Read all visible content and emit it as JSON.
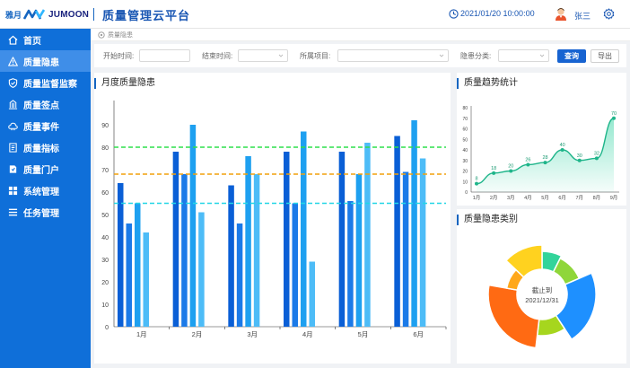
{
  "header": {
    "logo_cn": "雅月",
    "logo_en": "JUMOON",
    "title": "质量管理云平台",
    "datetime": "2021/01/20  10:00:00",
    "username": "张三"
  },
  "sidebar": {
    "items": [
      {
        "label": "首页",
        "icon": "home-icon"
      },
      {
        "label": "质量隐患",
        "icon": "warning-icon",
        "active": true
      },
      {
        "label": "质量监督监察",
        "icon": "shield-icon"
      },
      {
        "label": "质量签点",
        "icon": "checkpoint-icon"
      },
      {
        "label": "质量事件",
        "icon": "cloud-icon"
      },
      {
        "label": "质量指标",
        "icon": "document-icon"
      },
      {
        "label": "质量门户",
        "icon": "portal-icon"
      },
      {
        "label": "系统管理",
        "icon": "grid-icon"
      },
      {
        "label": "任务管理",
        "icon": "list-icon"
      }
    ]
  },
  "breadcrumb": "质量隐患",
  "filters": {
    "start_label": "开始时间:",
    "end_label": "结束时间:",
    "project_label": "所属项目:",
    "category_label": "隐患分类:",
    "query_button": "查询",
    "export_button": "导出"
  },
  "colors": {
    "brand": "#0f6fd9",
    "accent": "#1763d1",
    "line_green": "#1fb58a",
    "threshold_green": "#2ee04b",
    "threshold_orange": "#f2a10c",
    "threshold_cyan": "#23d6e6"
  },
  "monthly_panel": {
    "title": "月度质量隐患"
  },
  "trend_panel": {
    "title": "质量趋势统计"
  },
  "category_panel": {
    "title": "质量隐患类别",
    "center_line1": "截止到",
    "center_line2": "2021/12/31"
  },
  "chart_data": [
    {
      "type": "bar",
      "title": "月度质量隐患",
      "categories": [
        "1月",
        "2月",
        "3月",
        "4月",
        "5月",
        "6月"
      ],
      "series": [
        {
          "values": [
            64,
            78,
            63,
            78,
            78,
            85
          ]
        },
        {
          "values": [
            46,
            68,
            46,
            55,
            56,
            69
          ]
        },
        {
          "values": [
            55,
            90,
            76,
            87,
            68,
            92
          ]
        },
        {
          "values": [
            42,
            51,
            68,
            29,
            82,
            75
          ]
        }
      ],
      "thresholds": [
        80,
        68,
        55
      ],
      "yticks": [
        0,
        10,
        20,
        30,
        40,
        50,
        60,
        70,
        80,
        90
      ],
      "ylim": [
        0,
        100
      ]
    },
    {
      "type": "area",
      "title": "质量趋势统计",
      "categories": [
        "1月",
        "2月",
        "3月",
        "4月",
        "5月",
        "6月",
        "7月",
        "8月",
        "9月"
      ],
      "values": [
        8,
        18,
        20,
        26,
        28,
        40,
        30,
        32,
        70
      ],
      "point_labels": [
        "8",
        "18",
        "20",
        "26",
        "28",
        "40",
        "30",
        "32",
        "70"
      ],
      "yticks": [
        0,
        10,
        20,
        30,
        40,
        50,
        60,
        70,
        80
      ],
      "ylim": [
        0,
        80
      ]
    },
    {
      "type": "pie",
      "title": "质量隐患类别",
      "values": [
        8,
        12,
        24,
        12,
        28,
        10,
        14
      ],
      "colors": [
        "#33d49a",
        "#8fd63a",
        "#1e90ff",
        "#a6d61e",
        "#ff6a13",
        "#ffa81a",
        "#ffd21f"
      ]
    }
  ]
}
